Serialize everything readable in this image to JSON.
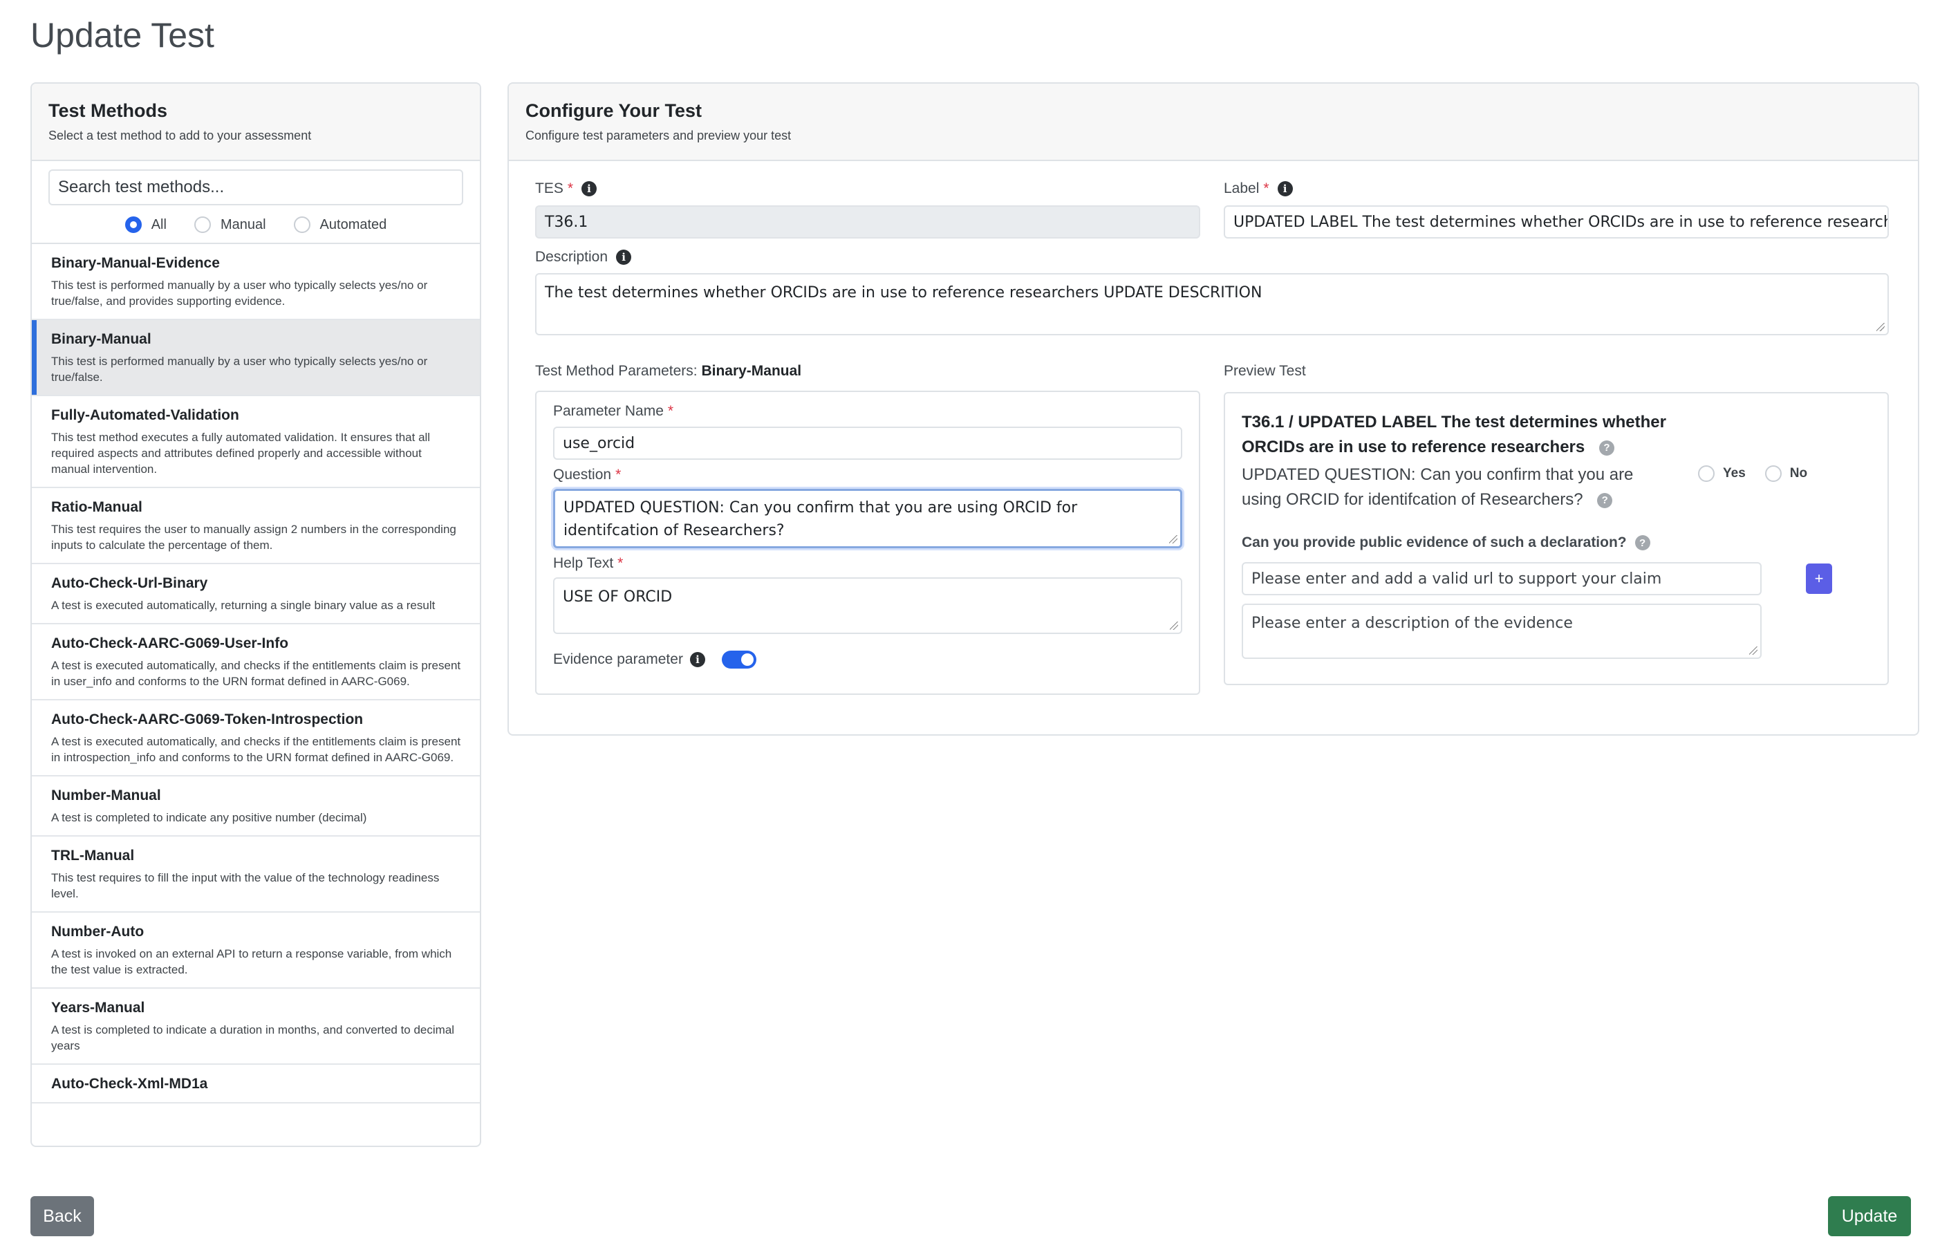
{
  "page": {
    "title": "Update Test"
  },
  "left": {
    "title": "Test Methods",
    "subtitle": "Select a test method to add to your assessment",
    "search_placeholder": "Search test methods...",
    "filters": [
      {
        "label": "All",
        "checked": true
      },
      {
        "label": "Manual",
        "checked": false
      },
      {
        "label": "Automated",
        "checked": false
      }
    ],
    "methods": [
      {
        "name": "Binary-Manual-Evidence",
        "desc": "This test is performed manually by a user who typically selects yes/no or true/false, and provides supporting evidence.",
        "active": false
      },
      {
        "name": "Binary-Manual",
        "desc": "This test is performed manually by a user who typically selects yes/no or true/false.",
        "active": true
      },
      {
        "name": "Fully-Automated-Validation",
        "desc": "This test method executes a fully automated validation. It ensures that all required aspects and attributes defined properly and accessible without manual intervention.",
        "active": false
      },
      {
        "name": "Ratio-Manual",
        "desc": "This test requires the user to manually assign 2 numbers in the corresponding inputs to calculate the percentage of them.",
        "active": false
      },
      {
        "name": "Auto-Check-Url-Binary",
        "desc": "A test is executed automatically, returning a single binary value as a result",
        "active": false
      },
      {
        "name": "Auto-Check-AARC-G069-User-Info",
        "desc": "A test is executed automatically, and checks if the entitlements claim is present in user_info and conforms to the URN format defined in AARC-G069.",
        "active": false
      },
      {
        "name": "Auto-Check-AARC-G069-Token-Introspection",
        "desc": "A test is executed automatically, and checks if the entitlements claim is present in introspection_info and conforms to the URN format defined in AARC-G069.",
        "active": false
      },
      {
        "name": "Number-Manual",
        "desc": "A test is completed to indicate any positive number (decimal)",
        "active": false
      },
      {
        "name": "TRL-Manual",
        "desc": "This test requires to fill the input with the value of the technology readiness level.",
        "active": false
      },
      {
        "name": "Number-Auto",
        "desc": "A test is invoked on an external API to return a response variable, from which the test value is extracted.",
        "active": false
      },
      {
        "name": "Years-Manual",
        "desc": "A test is completed to indicate a duration in months, and converted to decimal years",
        "active": false
      },
      {
        "name": "Auto-Check-Xml-MD1a",
        "desc": "",
        "active": false
      }
    ]
  },
  "config": {
    "title": "Configure Your Test",
    "subtitle": "Configure test parameters and preview your test",
    "tes_label": "TES",
    "tes_value": "T36.1",
    "label_label": "Label",
    "label_value": "UPDATED LABEL The test determines whether ORCIDs are in use to reference researchers",
    "description_label": "Description",
    "description_value": "The test determines whether ORCIDs are in use to reference researchers UPDATE DESCRITION",
    "params_heading": "Test Method Parameters:",
    "params_method": "Binary-Manual",
    "param_name_label": "Parameter Name",
    "param_name_value": "use_orcid",
    "question_label": "Question",
    "question_value": "UPDATED QUESTION: Can you confirm that you are using ORCID for identifcation of Researchers?",
    "help_label": "Help Text",
    "help_value": "USE OF ORCID",
    "evidence_label": "Evidence parameter",
    "evidence_enabled": true
  },
  "preview": {
    "heading": "Preview Test",
    "title": "T36.1 / UPDATED LABEL The test determines whether ORCIDs are in use to reference researchers",
    "question": "UPDATED QUESTION: Can you confirm that you are using ORCID for identifcation of Researchers?",
    "yes_label": "Yes",
    "no_label": "No",
    "evidence_question": "Can you provide public evidence of such a declaration?",
    "url_placeholder": "Please enter and add a valid url to support your claim",
    "desc_placeholder": "Please enter a description of the evidence",
    "add_label": "+"
  },
  "actions": {
    "back": "Back",
    "update": "Update"
  },
  "colors": {
    "primary": "#2563eb",
    "success": "#2f7d4f",
    "secondary": "#6c737a",
    "required": "#dc3545",
    "add_button": "#5b5ee6"
  }
}
